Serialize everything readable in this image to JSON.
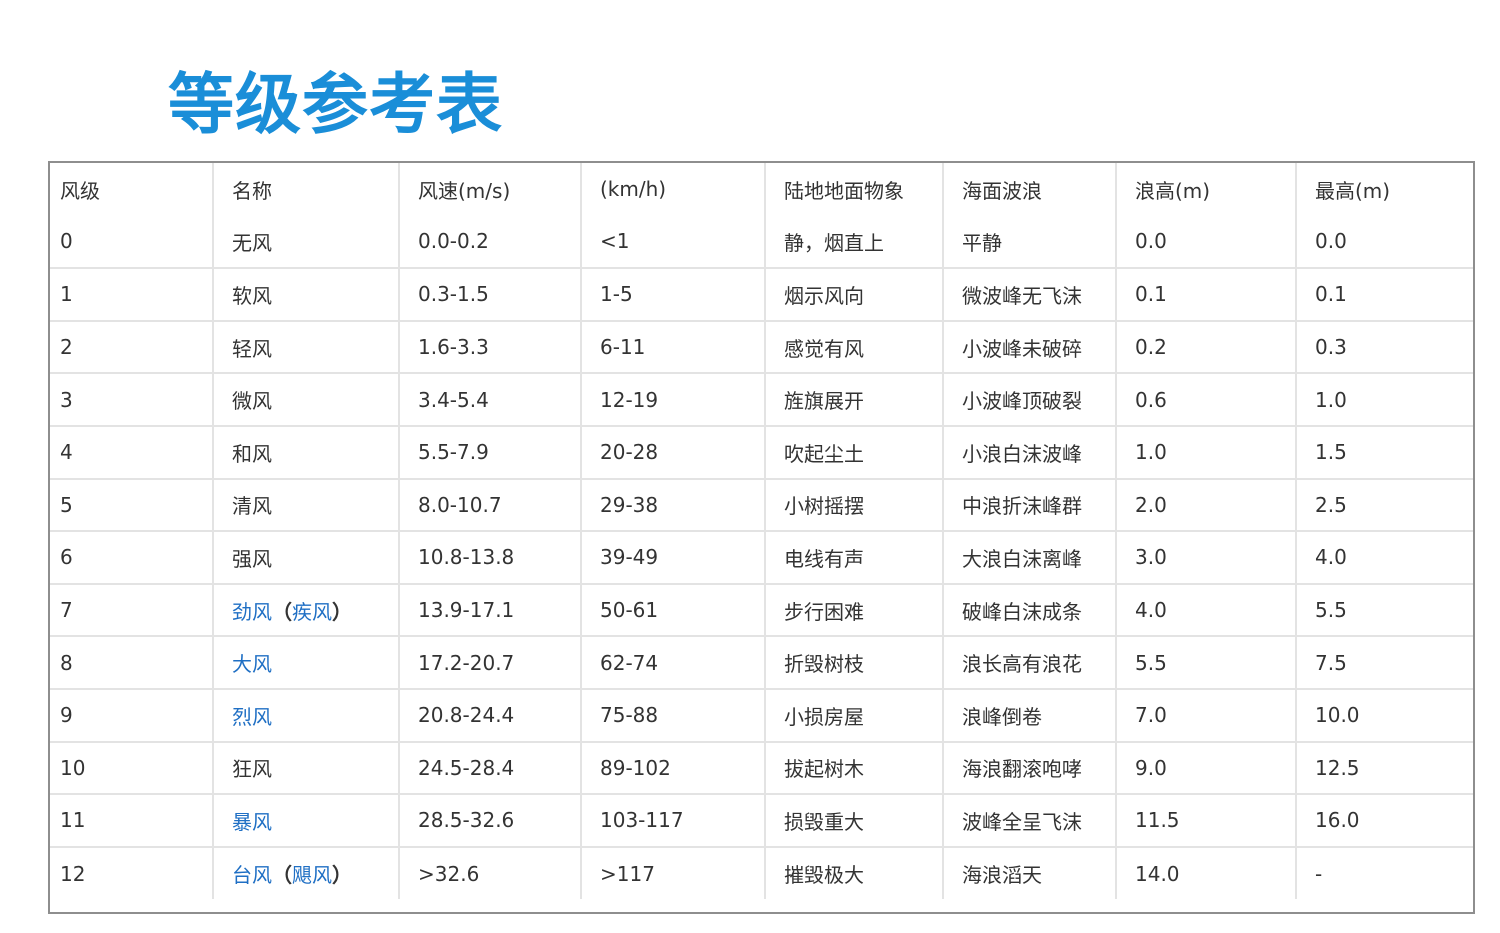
{
  "title": "等级参考表",
  "colors": {
    "title": "#1a8ed8",
    "link": "#1f6fc4",
    "text": "#333333"
  },
  "columns": [
    "风级",
    "名称",
    "风速(m/s)",
    "(km/h)",
    "陆地地面物象",
    "海面波浪",
    "浪高(m)",
    "最高(m)"
  ],
  "rows": [
    {
      "level": "0",
      "name": "无风",
      "name_linked": false,
      "alt": "",
      "alt_linked": false,
      "speed_ms": "0.0-0.2",
      "speed_kmh": "<1",
      "land": "静，烟直上",
      "sea": "平静",
      "wave": "0.0",
      "max": "0.0"
    },
    {
      "level": "1",
      "name": "软风",
      "name_linked": false,
      "alt": "",
      "alt_linked": false,
      "speed_ms": "0.3-1.5",
      "speed_kmh": "1-5",
      "land": "烟示风向",
      "sea": "微波峰无飞沫",
      "wave": "0.1",
      "max": "0.1"
    },
    {
      "level": "2",
      "name": "轻风",
      "name_linked": false,
      "alt": "",
      "alt_linked": false,
      "speed_ms": "1.6-3.3",
      "speed_kmh": "6-11",
      "land": "感觉有风",
      "sea": "小波峰未破碎",
      "wave": "0.2",
      "max": "0.3"
    },
    {
      "level": "3",
      "name": "微风",
      "name_linked": false,
      "alt": "",
      "alt_linked": false,
      "speed_ms": "3.4-5.4",
      "speed_kmh": "12-19",
      "land": "旌旗展开",
      "sea": "小波峰顶破裂",
      "wave": "0.6",
      "max": "1.0"
    },
    {
      "level": "4",
      "name": "和风",
      "name_linked": false,
      "alt": "",
      "alt_linked": false,
      "speed_ms": "5.5-7.9",
      "speed_kmh": "20-28",
      "land": "吹起尘土",
      "sea": "小浪白沫波峰",
      "wave": "1.0",
      "max": "1.5"
    },
    {
      "level": "5",
      "name": "清风",
      "name_linked": false,
      "alt": "",
      "alt_linked": false,
      "speed_ms": "8.0-10.7",
      "speed_kmh": "29-38",
      "land": "小树摇摆",
      "sea": "中浪折沫峰群",
      "wave": "2.0",
      "max": "2.5"
    },
    {
      "level": "6",
      "name": "强风",
      "name_linked": false,
      "alt": "",
      "alt_linked": false,
      "speed_ms": "10.8-13.8",
      "speed_kmh": "39-49",
      "land": "电线有声",
      "sea": "大浪白沫离峰",
      "wave": "3.0",
      "max": "4.0"
    },
    {
      "level": "7",
      "name": "劲风",
      "name_linked": true,
      "alt": "疾风",
      "alt_linked": true,
      "speed_ms": "13.9-17.1",
      "speed_kmh": "50-61",
      "land": "步行困难",
      "sea": "破峰白沫成条",
      "wave": "4.0",
      "max": "5.5"
    },
    {
      "level": "8",
      "name": "大风",
      "name_linked": true,
      "alt": "",
      "alt_linked": false,
      "speed_ms": "17.2-20.7",
      "speed_kmh": "62-74",
      "land": "折毁树枝",
      "sea": "浪长高有浪花",
      "wave": "5.5",
      "max": "7.5"
    },
    {
      "level": "9",
      "name": "烈风",
      "name_linked": true,
      "alt": "",
      "alt_linked": false,
      "speed_ms": "20.8-24.4",
      "speed_kmh": "75-88",
      "land": "小损房屋",
      "sea": "浪峰倒卷",
      "wave": "7.0",
      "max": "10.0"
    },
    {
      "level": "10",
      "name": "狂风",
      "name_linked": false,
      "alt": "",
      "alt_linked": false,
      "speed_ms": "24.5-28.4",
      "speed_kmh": "89-102",
      "land": "拔起树木",
      "sea": "海浪翻滚咆哮",
      "wave": "9.0",
      "max": "12.5"
    },
    {
      "level": "11",
      "name": "暴风",
      "name_linked": true,
      "alt": "",
      "alt_linked": false,
      "speed_ms": "28.5-32.6",
      "speed_kmh": "103-117",
      "land": "损毁重大",
      "sea": "波峰全呈飞沫",
      "wave": "11.5",
      "max": "16.0"
    },
    {
      "level": "12",
      "name": "台风",
      "name_linked": true,
      "alt": "飓风",
      "alt_linked": true,
      "speed_ms": ">32.6",
      "speed_kmh": ">117",
      "land": "摧毁极大",
      "sea": "海浪滔天",
      "wave": "14.0",
      "max": "-"
    }
  ]
}
